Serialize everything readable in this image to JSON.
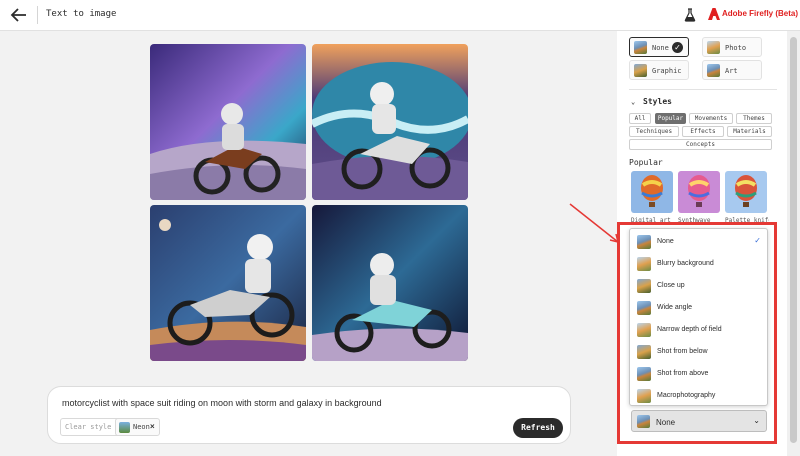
{
  "header": {
    "back_icon": "arrow-left-icon",
    "title": "Text to image",
    "beta_icon": "flask-icon",
    "brand": "Adobe Firefly (Beta)"
  },
  "images": [
    {
      "id": "result-1"
    },
    {
      "id": "result-2"
    },
    {
      "id": "result-3"
    },
    {
      "id": "result-4"
    }
  ],
  "prompt": {
    "text": "motorcyclist with space suit riding on moon with storm and galaxy in background",
    "clear_style_label": "Clear style",
    "chip_label": "Neon",
    "chip_close": "×",
    "refresh_label": "Refresh"
  },
  "sidebar": {
    "content_types": [
      {
        "label": "None",
        "selected": true
      },
      {
        "label": "Photo",
        "selected": false
      },
      {
        "label": "Graphic",
        "selected": false
      },
      {
        "label": "Art",
        "selected": false
      }
    ],
    "styles_heading": "Styles",
    "tabs": [
      {
        "label": "All"
      },
      {
        "label": "Popular"
      },
      {
        "label": "Movements"
      },
      {
        "label": "Themes"
      },
      {
        "label": "Techniques"
      },
      {
        "label": "Effects"
      },
      {
        "label": "Materials"
      },
      {
        "label": "Concepts"
      }
    ],
    "active_tab": "Popular",
    "popular_heading": "Popular",
    "popular_items": [
      {
        "label": "Digital art"
      },
      {
        "label": "Synthwave"
      },
      {
        "label": "Palette knife"
      }
    ]
  },
  "dropdown": {
    "options": [
      {
        "label": "None",
        "checked": true
      },
      {
        "label": "Blurry background",
        "checked": false
      },
      {
        "label": "Close up",
        "checked": false
      },
      {
        "label": "Wide angle",
        "checked": false
      },
      {
        "label": "Narrow depth of field",
        "checked": false
      },
      {
        "label": "Shot from below",
        "checked": false
      },
      {
        "label": "Shot from above",
        "checked": false
      },
      {
        "label": "Macrophotography",
        "checked": false
      }
    ],
    "check_glyph": "✓",
    "selected_value": "None",
    "chevron_icon": "chevron-down-icon"
  },
  "colors": {
    "highlight": "#e53935",
    "brand_red": "#e02020",
    "refresh_bg": "#2b2b2b",
    "active_tab": "#6f6f6f"
  }
}
